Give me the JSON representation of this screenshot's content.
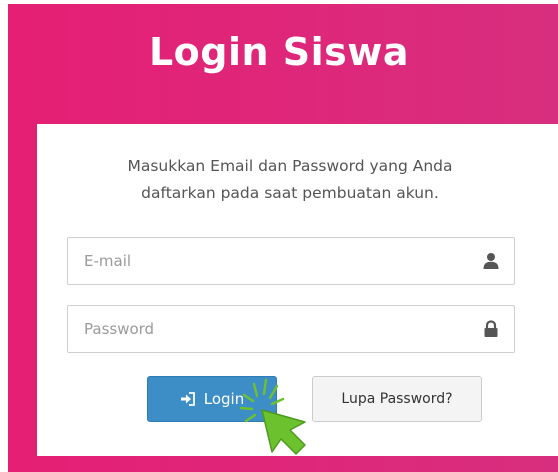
{
  "header": {
    "title": "Login Siswa"
  },
  "form": {
    "instruction_line1": "Masukkan Email dan Password yang Anda",
    "instruction_line2": "daftarkan pada saat pembuatan akun.",
    "email_placeholder": "E-mail",
    "password_placeholder": "Password",
    "login_label": "Login",
    "forgot_label": "Lupa Password?"
  },
  "icons": {
    "email": "user-icon",
    "password": "lock-icon",
    "login": "sign-in-icon",
    "cursor": "pointer-cursor-icon"
  },
  "colors": {
    "header_gradient_start": "#e51f74",
    "header_gradient_end": "#d82e7f",
    "login_button": "#3d8dc6",
    "cursor_arrow": "#6cc12f"
  }
}
